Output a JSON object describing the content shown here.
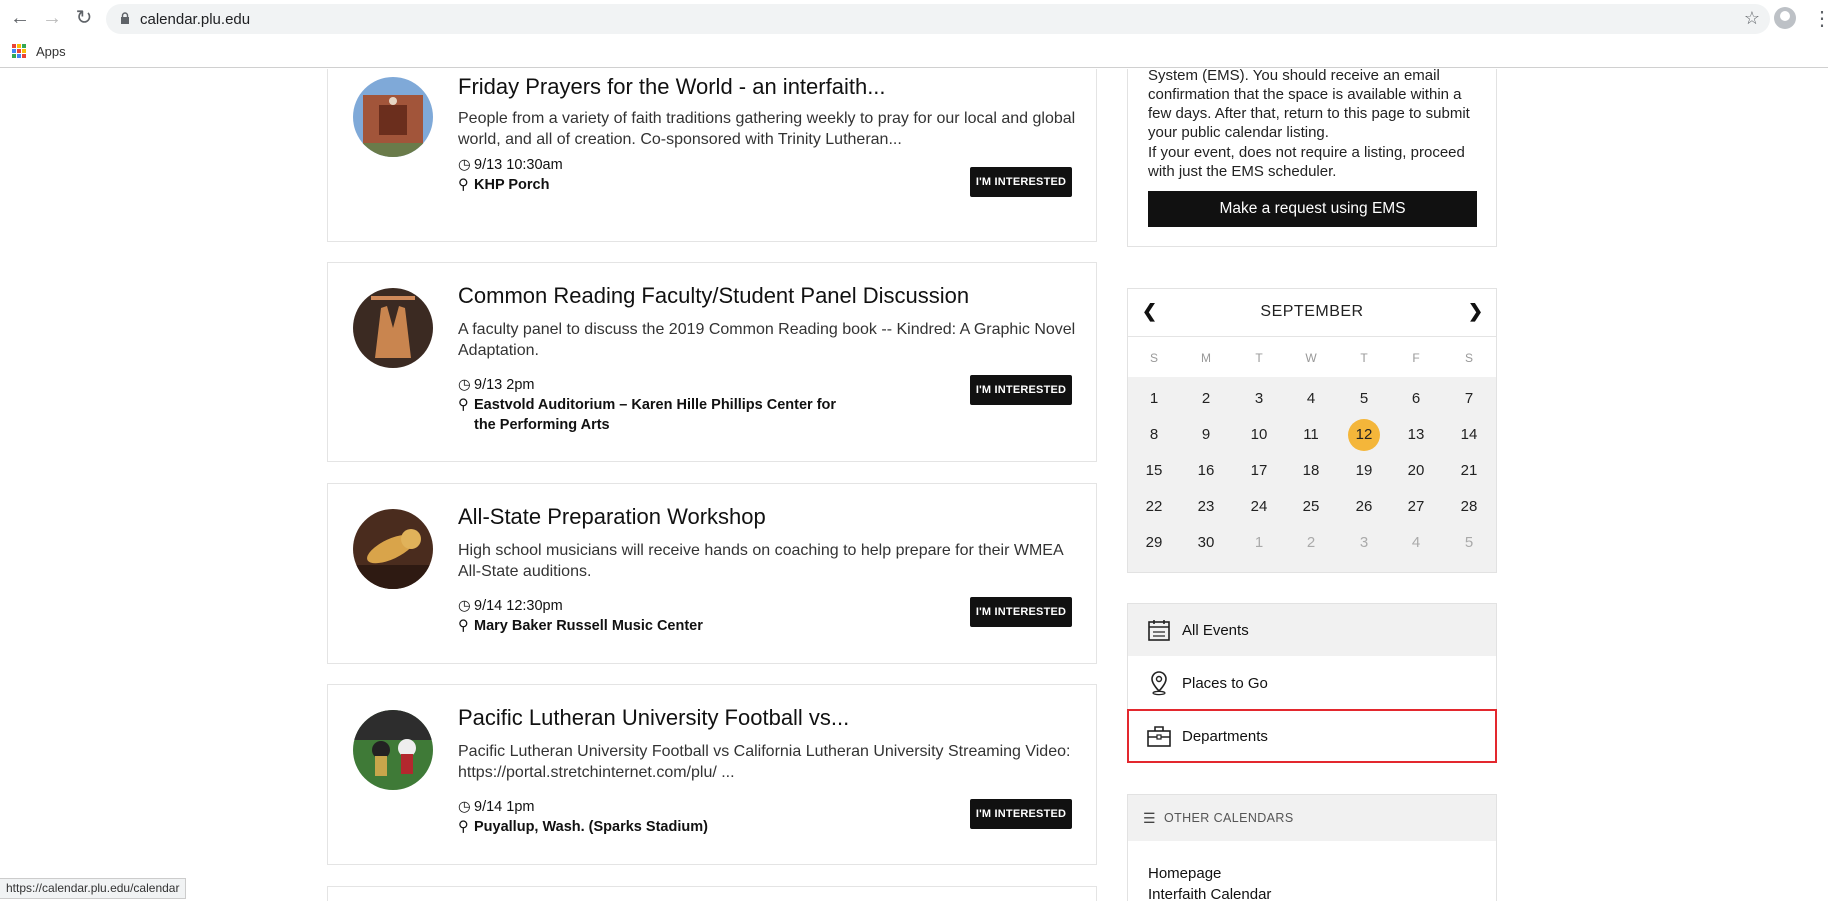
{
  "browser": {
    "url": "calendar.plu.edu",
    "bookmarks": {
      "apps_label": "Apps"
    },
    "status_url": "https://calendar.plu.edu/calendar"
  },
  "events": [
    {
      "title": "Friday Prayers for the World - an interfaith...",
      "description": "People from a variety of faith traditions gathering weekly to pray for our local and global world, and all of creation. Co-sponsored with Trinity Lutheran...",
      "time": "9/13 10:30am",
      "location": "KHP Porch",
      "button": "I'M INTERESTED"
    },
    {
      "title": "Common Reading Faculty/Student Panel Discussion",
      "description": "A faculty panel to discuss the 2019 Common Reading book -- Kindred: A Graphic Novel Adaptation.",
      "time": "9/13 2pm",
      "location": "Eastvold Auditorium – Karen Hille Phillips Center for the Performing Arts",
      "button": "I'M INTERESTED"
    },
    {
      "title": "All-State Preparation Workshop",
      "description": "High school musicians will receive hands on coaching to help prepare for their WMEA All-State auditions.",
      "time": "9/14 12:30pm",
      "location": "Mary Baker Russell Music Center",
      "button": "I'M INTERESTED"
    },
    {
      "title": "Pacific Lutheran University Football vs...",
      "description": "Pacific Lutheran University Football vs California Lutheran University Streaming Video: https://portal.stretchinternet.com/plu/ ...",
      "time": "9/14 1pm",
      "location": "Puyallup, Wash. (Sparks Stadium)",
      "button": "I'M INTERESTED"
    }
  ],
  "ems": {
    "text1": "System (EMS). You should receive an email confirmation that the space is available within a few days. After that, return to this page to submit your public calendar listing.",
    "text2": "If your event, does not require a listing, proceed with just the EMS scheduler.",
    "button": "Make a request using EMS"
  },
  "calendar": {
    "month": "SEPTEMBER",
    "weekdays": [
      "S",
      "M",
      "T",
      "W",
      "T",
      "F",
      "S"
    ],
    "weeks": [
      [
        "1",
        "2",
        "3",
        "4",
        "5",
        "6",
        "7"
      ],
      [
        "8",
        "9",
        "10",
        "11",
        "12",
        "13",
        "14"
      ],
      [
        "15",
        "16",
        "17",
        "18",
        "19",
        "20",
        "21"
      ],
      [
        "22",
        "23",
        "24",
        "25",
        "26",
        "27",
        "28"
      ],
      [
        "29",
        "30",
        "1",
        "2",
        "3",
        "4",
        "5"
      ]
    ],
    "today": "12"
  },
  "nav_links": {
    "all_events": "All Events",
    "places": "Places to Go",
    "departments": "Departments"
  },
  "other_calendars": {
    "heading": "OTHER CALENDARS",
    "links": [
      "Homepage",
      "Interfaith Calendar"
    ]
  },
  "colors": {
    "accent_today": "#f4b63a",
    "highlight": "#e3282e"
  }
}
